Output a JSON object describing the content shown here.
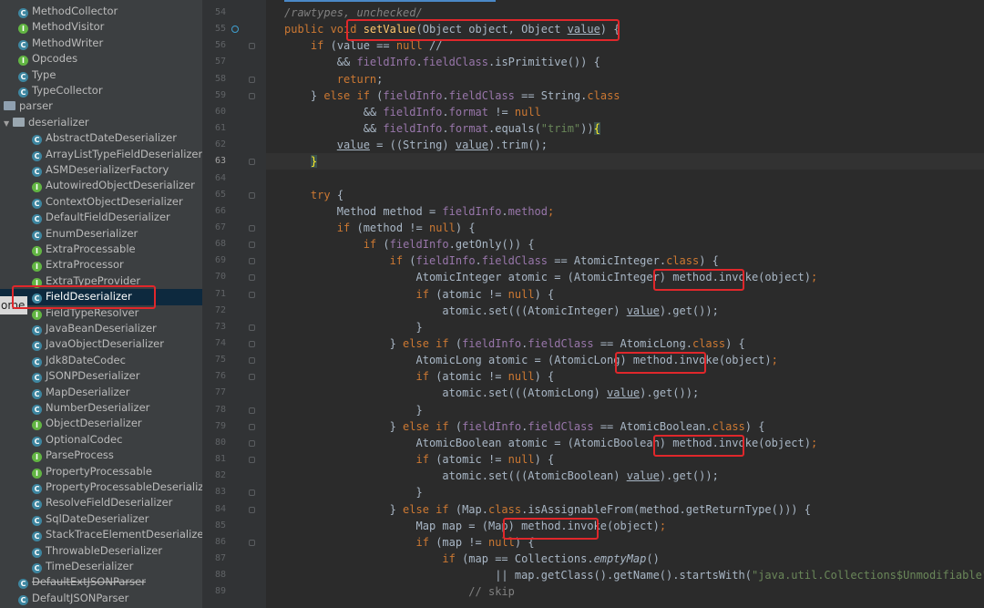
{
  "project_tree": {
    "items": [
      {
        "label": "MethodCollector",
        "type": "class",
        "indent": 2
      },
      {
        "label": "MethodVisitor",
        "type": "iface",
        "indent": 2
      },
      {
        "label": "MethodWriter",
        "type": "class",
        "indent": 2
      },
      {
        "label": "Opcodes",
        "type": "iface",
        "indent": 2
      },
      {
        "label": "Type",
        "type": "class",
        "indent": 2
      },
      {
        "label": "TypeCollector",
        "type": "class",
        "indent": 2
      },
      {
        "label": "parser",
        "type": "folder",
        "indent": 0
      },
      {
        "label": "deserializer",
        "type": "folder-open",
        "indent": 1
      },
      {
        "label": "AbstractDateDeserializer",
        "type": "class",
        "indent": 3
      },
      {
        "label": "ArrayListTypeFieldDeserializer",
        "type": "class",
        "indent": 3
      },
      {
        "label": "ASMDeserializerFactory",
        "type": "class",
        "indent": 3
      },
      {
        "label": "AutowiredObjectDeserializer",
        "type": "iface",
        "indent": 3
      },
      {
        "label": "ContextObjectDeserializer",
        "type": "class",
        "indent": 3
      },
      {
        "label": "DefaultFieldDeserializer",
        "type": "class",
        "indent": 3
      },
      {
        "label": "EnumDeserializer",
        "type": "class",
        "indent": 3
      },
      {
        "label": "ExtraProcessable",
        "type": "iface",
        "indent": 3
      },
      {
        "label": "ExtraProcessor",
        "type": "iface",
        "indent": 3
      },
      {
        "label": "ExtraTypeProvider",
        "type": "iface",
        "indent": 3
      },
      {
        "label": "FieldDeserializer",
        "type": "class",
        "indent": 3,
        "selected": true
      },
      {
        "label": "FieldTypeResolver",
        "type": "iface",
        "indent": 3
      },
      {
        "label": "JavaBeanDeserializer",
        "type": "class",
        "indent": 3
      },
      {
        "label": "JavaObjectDeserializer",
        "type": "class",
        "indent": 3
      },
      {
        "label": "Jdk8DateCodec",
        "type": "class",
        "indent": 3
      },
      {
        "label": "JSONPDeserializer",
        "type": "class",
        "indent": 3
      },
      {
        "label": "MapDeserializer",
        "type": "class",
        "indent": 3
      },
      {
        "label": "NumberDeserializer",
        "type": "class",
        "indent": 3
      },
      {
        "label": "ObjectDeserializer",
        "type": "iface",
        "indent": 3
      },
      {
        "label": "OptionalCodec",
        "type": "class",
        "indent": 3
      },
      {
        "label": "ParseProcess",
        "type": "iface",
        "indent": 3
      },
      {
        "label": "PropertyProcessable",
        "type": "iface",
        "indent": 3
      },
      {
        "label": "PropertyProcessableDeserializer",
        "type": "class",
        "indent": 3
      },
      {
        "label": "ResolveFieldDeserializer",
        "type": "class",
        "indent": 3
      },
      {
        "label": "SqlDateDeserializer",
        "type": "class",
        "indent": 3
      },
      {
        "label": "StackTraceElementDeserializer",
        "type": "class",
        "indent": 3
      },
      {
        "label": "ThrowableDeserializer",
        "type": "class",
        "indent": 3
      },
      {
        "label": "TimeDeserializer",
        "type": "class",
        "indent": 3
      },
      {
        "label": "DefaultExtJSONParser",
        "type": "class",
        "indent": 2,
        "strike": true
      },
      {
        "label": "DefaultJSONParser",
        "type": "class",
        "indent": 2
      }
    ],
    "popup_text": "ome"
  },
  "editor": {
    "first_line": 54,
    "caret_line": 63,
    "lines": [
      [
        [
          "cm it",
          "/rawtypes, unchecked/"
        ]
      ],
      [
        [
          "kw",
          "public void "
        ],
        [
          "fn",
          "setValue"
        ],
        [
          "",
          "(Object object, Object "
        ],
        [
          "ul",
          "value"
        ],
        [
          "",
          ") {"
        ]
      ],
      [
        [
          "",
          "    "
        ],
        [
          "kw",
          "if "
        ],
        [
          "",
          "(value == "
        ],
        [
          "kw",
          "null "
        ],
        [
          "",
          "//"
        ]
      ],
      [
        [
          "",
          "        && "
        ],
        [
          "fld",
          "fieldInfo"
        ],
        [
          "",
          "."
        ],
        [
          "fld",
          "fieldClass"
        ],
        [
          "",
          ".isPrimitive()) {"
        ]
      ],
      [
        [
          "",
          "        "
        ],
        [
          "kw",
          "return"
        ],
        [
          "",
          ";"
        ]
      ],
      [
        [
          "",
          "    } "
        ],
        [
          "kw",
          "else if "
        ],
        [
          "",
          "("
        ],
        [
          "fld",
          "fieldInfo"
        ],
        [
          "",
          "."
        ],
        [
          "fld",
          "fieldClass"
        ],
        [
          "",
          " == String."
        ],
        [
          "kw",
          "class"
        ]
      ],
      [
        [
          "",
          "            && "
        ],
        [
          "fld",
          "fieldInfo"
        ],
        [
          "",
          "."
        ],
        [
          "fld",
          "format "
        ],
        [
          "",
          "!= "
        ],
        [
          "kw",
          "null"
        ]
      ],
      [
        [
          "",
          "            && "
        ],
        [
          "fld",
          "fieldInfo"
        ],
        [
          "",
          "."
        ],
        [
          "fld",
          "format"
        ],
        [
          "",
          ".equals("
        ],
        [
          "str",
          "\"trim\""
        ],
        [
          "",
          "))"
        ],
        [
          "br",
          "{"
        ]
      ],
      [
        [
          "",
          "        "
        ],
        [
          "ul",
          "value"
        ],
        [
          "",
          " = ((String) "
        ],
        [
          "ul",
          "value"
        ],
        [
          "",
          ").trim();"
        ]
      ],
      [
        [
          "",
          "    "
        ],
        [
          "br",
          "}"
        ]
      ],
      [
        [
          "",
          ""
        ]
      ],
      [
        [
          "",
          "    "
        ],
        [
          "kw",
          "try "
        ],
        [
          "",
          "{"
        ]
      ],
      [
        [
          "",
          "        Method method = "
        ],
        [
          "fld",
          "fieldInfo"
        ],
        [
          "",
          "."
        ],
        [
          "fld",
          "method"
        ],
        [
          "kw",
          ";"
        ]
      ],
      [
        [
          "",
          "        "
        ],
        [
          "kw",
          "if "
        ],
        [
          "",
          "(method != "
        ],
        [
          "kw",
          "null"
        ],
        [
          "",
          ") {"
        ]
      ],
      [
        [
          "",
          "            "
        ],
        [
          "kw",
          "if "
        ],
        [
          "",
          "("
        ],
        [
          "fld",
          "fieldInfo"
        ],
        [
          "",
          ".getOnly()) {"
        ]
      ],
      [
        [
          "",
          "                "
        ],
        [
          "kw",
          "if "
        ],
        [
          "",
          "("
        ],
        [
          "fld",
          "fieldInfo"
        ],
        [
          "",
          "."
        ],
        [
          "fld",
          "fieldClass"
        ],
        [
          "",
          " == AtomicInteger."
        ],
        [
          "kw",
          "class"
        ],
        [
          "",
          ") {"
        ]
      ],
      [
        [
          "",
          "                    AtomicInteger atomic = (AtomicInteger) method.invoke(object)"
        ],
        [
          "kw",
          ";"
        ]
      ],
      [
        [
          "",
          "                    "
        ],
        [
          "kw",
          "if "
        ],
        [
          "",
          "(atomic != "
        ],
        [
          "kw",
          "null"
        ],
        [
          "",
          ") {"
        ]
      ],
      [
        [
          "",
          "                        atomic.set(((AtomicInteger) "
        ],
        [
          "ul",
          "value"
        ],
        [
          "",
          ").get());"
        ]
      ],
      [
        [
          "",
          "                    }"
        ]
      ],
      [
        [
          "",
          "                } "
        ],
        [
          "kw",
          "else if "
        ],
        [
          "",
          "("
        ],
        [
          "fld",
          "fieldInfo"
        ],
        [
          "",
          "."
        ],
        [
          "fld",
          "fieldClass"
        ],
        [
          "",
          " == AtomicLong."
        ],
        [
          "kw",
          "class"
        ],
        [
          "",
          ") {"
        ]
      ],
      [
        [
          "",
          "                    AtomicLong atomic = (AtomicLong) method.invoke(object)"
        ],
        [
          "kw",
          ";"
        ]
      ],
      [
        [
          "",
          "                    "
        ],
        [
          "kw",
          "if "
        ],
        [
          "",
          "(atomic != "
        ],
        [
          "kw",
          "null"
        ],
        [
          "",
          ") {"
        ]
      ],
      [
        [
          "",
          "                        atomic.set(((AtomicLong) "
        ],
        [
          "ul",
          "value"
        ],
        [
          "",
          ").get());"
        ]
      ],
      [
        [
          "",
          "                    }"
        ]
      ],
      [
        [
          "",
          "                } "
        ],
        [
          "kw",
          "else if "
        ],
        [
          "",
          "("
        ],
        [
          "fld",
          "fieldInfo"
        ],
        [
          "",
          "."
        ],
        [
          "fld",
          "fieldClass"
        ],
        [
          "",
          " == AtomicBoolean."
        ],
        [
          "kw",
          "class"
        ],
        [
          "",
          ") {"
        ]
      ],
      [
        [
          "",
          "                    AtomicBoolean atomic = (AtomicBoolean) method.invoke(object)"
        ],
        [
          "kw",
          ";"
        ]
      ],
      [
        [
          "",
          "                    "
        ],
        [
          "kw",
          "if "
        ],
        [
          "",
          "(atomic != "
        ],
        [
          "kw",
          "null"
        ],
        [
          "",
          ") {"
        ]
      ],
      [
        [
          "",
          "                        atomic.set(((AtomicBoolean) "
        ],
        [
          "ul",
          "value"
        ],
        [
          "",
          ").get());"
        ]
      ],
      [
        [
          "",
          "                    }"
        ]
      ],
      [
        [
          "",
          "                } "
        ],
        [
          "kw",
          "else if "
        ],
        [
          "",
          "(Map."
        ],
        [
          "kw",
          "class"
        ],
        [
          "",
          ".isAssignableFrom(method.getReturnType())) {"
        ]
      ],
      [
        [
          "",
          "                    Map map = (Map) method.invoke(object)"
        ],
        [
          "kw",
          ";"
        ]
      ],
      [
        [
          "",
          "                    "
        ],
        [
          "kw",
          "if "
        ],
        [
          "",
          "(map != "
        ],
        [
          "kw",
          "null"
        ],
        [
          "",
          ") {"
        ]
      ],
      [
        [
          "",
          "                        "
        ],
        [
          "kw",
          "if "
        ],
        [
          "",
          "(map == Collections."
        ],
        [
          "it",
          "emptyMap"
        ],
        [
          "",
          "()"
        ]
      ],
      [
        [
          "",
          "                                || map.getClass().getName().startsWith("
        ],
        [
          "str",
          "\"java.util.Collections$Unmodifiable\""
        ],
        [
          "",
          "))"
        ]
      ],
      [
        [
          "",
          "                            "
        ],
        [
          "cm",
          "// skip"
        ]
      ]
    ]
  },
  "highlights_label": "red annotation boxes"
}
